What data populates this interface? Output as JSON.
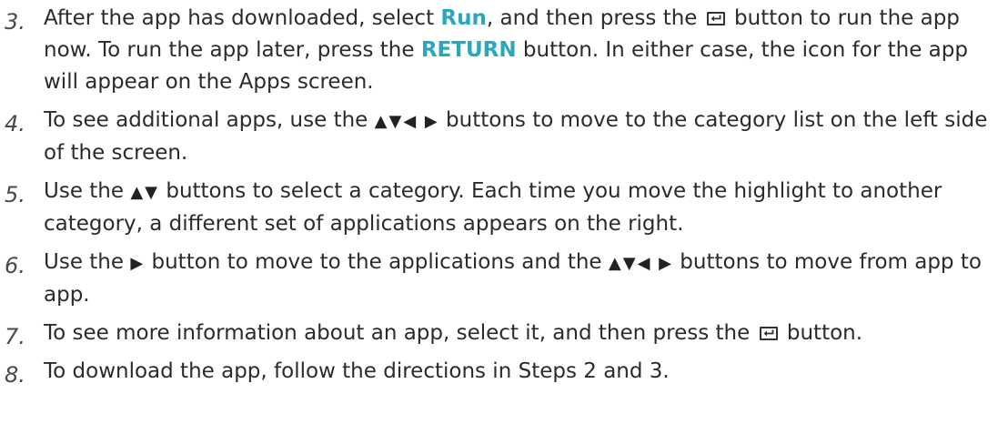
{
  "steps": [
    {
      "number": "3.",
      "t1": "After the app has downloaded, select ",
      "run": "Run",
      "t2": ", and then press the ",
      "t3": " button to run the app now. To run the app later, press the ",
      "return": "RETURN",
      "t4": " button. In either case, the icon for the app will appear on the Apps screen."
    },
    {
      "number": "4.",
      "t1": "To see additional apps, use the ",
      "arrows": "▲▼◀ ▶",
      "t2": " buttons to move to the category list on the left side of the screen."
    },
    {
      "number": "5.",
      "t1": "Use the ",
      "arrows": "▲▼",
      "t2": " buttons to select a category. Each time you move the highlight to another category, a different set of applications appears on the right."
    },
    {
      "number": "6.",
      "t1": "Use the ",
      "arrow_right": "▶",
      "t2": " button to move to the applications and the ",
      "arrows": "▲▼◀ ▶",
      "t3": " buttons to move from app to app."
    },
    {
      "number": "7.",
      "t1": "To see more information about an app, select it, and then press the ",
      "t2": " button."
    },
    {
      "number": "8.",
      "t1": "To download the app, follow the directions in Steps 2 and 3."
    }
  ],
  "icons": {
    "enter_button": "enter-button-icon"
  },
  "colors": {
    "highlight": "#2aa6bd",
    "text": "#2b2b2b"
  }
}
